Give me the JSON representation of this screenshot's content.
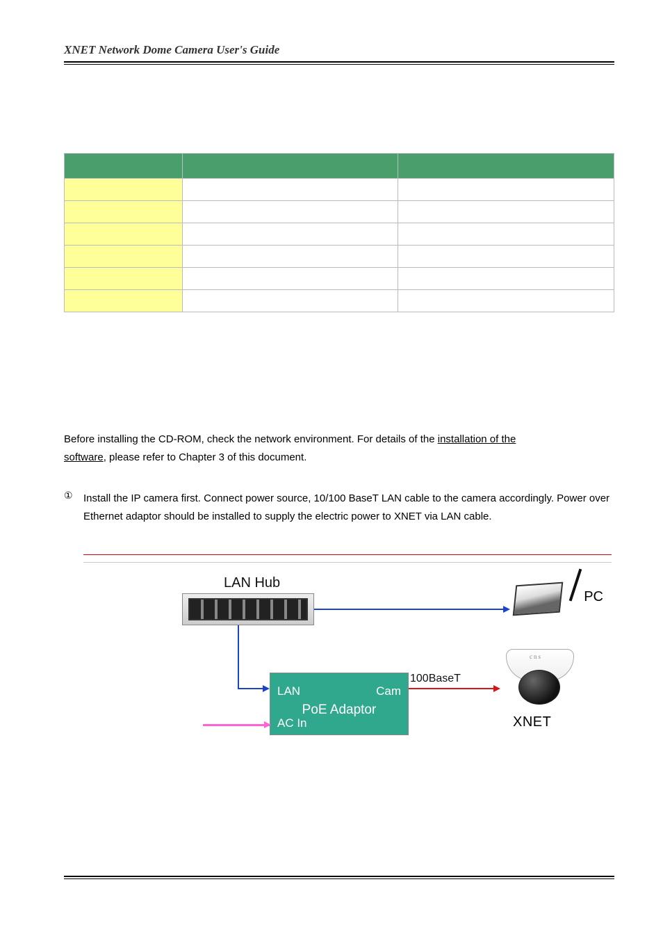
{
  "header": {
    "title": "XNET Network Dome Camera User's Guide"
  },
  "spec_table": {
    "rows": [
      {
        "key": "",
        "v1": "",
        "v2": ""
      },
      {
        "key": "",
        "v1": "",
        "v2": ""
      },
      {
        "key": "",
        "v1": "",
        "v2": ""
      },
      {
        "key": "",
        "v1": "",
        "v2": ""
      },
      {
        "key": "",
        "v1": "",
        "v2": ""
      },
      {
        "key": "",
        "v1": "",
        "v2": ""
      }
    ]
  },
  "install": {
    "line1": "Before installing the CD-ROM, check the network environment. For details of the ",
    "line1_u": "installation of the",
    "line2_u": " software",
    "line2_rest": ", please refer to Chapter 3 of this document."
  },
  "step1": {
    "num": "①",
    "body": "Install the IP camera first. Connect power source, 10/100 BaseT LAN cable to the camera accordingly. Power over Ethernet adaptor should be installed to supply the electric power to XNET via LAN cable."
  },
  "diagram": {
    "lanhub": "LAN Hub",
    "pc": "PC",
    "hundred": "100BaseT",
    "lan": "LAN",
    "cam": "Cam",
    "poe_title": "PoE Adaptor",
    "acin": "AC In",
    "cns": "cns",
    "xnet": "XNET"
  }
}
